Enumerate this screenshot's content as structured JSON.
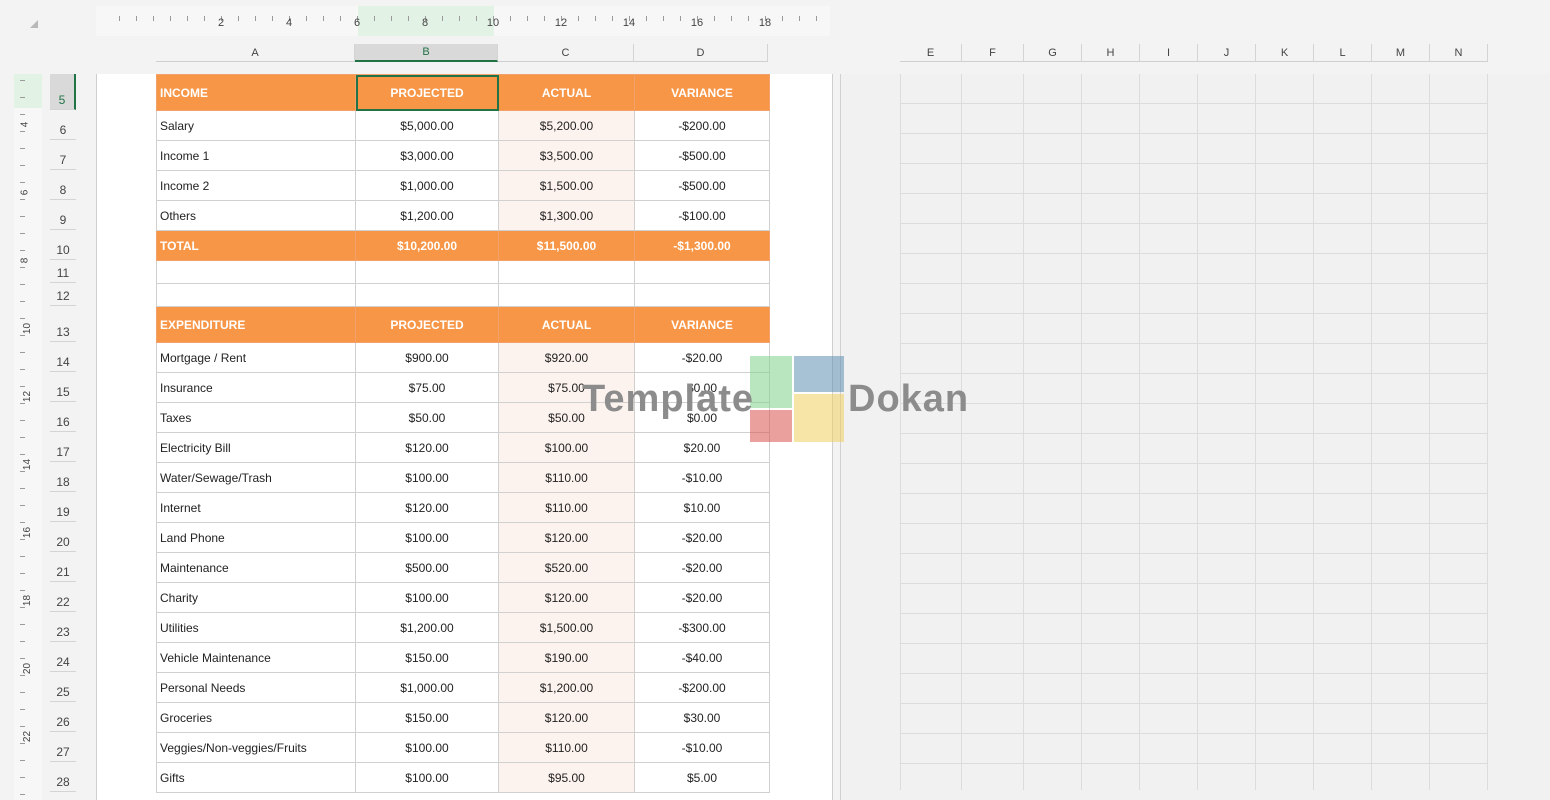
{
  "ruler": {
    "numbers": [
      "2",
      "4",
      "6",
      "8",
      "10",
      "12",
      "14",
      "16",
      "18"
    ],
    "vnumbers": [
      "4",
      "6",
      "8",
      "10",
      "12",
      "14",
      "16",
      "18",
      "20",
      "22"
    ]
  },
  "columns": [
    "A",
    "B",
    "C",
    "D",
    "E",
    "F",
    "G",
    "H",
    "I",
    "J",
    "K",
    "L",
    "M",
    "N"
  ],
  "rows": [
    "5",
    "6",
    "7",
    "8",
    "9",
    "10",
    "11",
    "12",
    "13",
    "14",
    "15",
    "16",
    "17",
    "18",
    "19",
    "20",
    "21",
    "22",
    "23",
    "24",
    "25",
    "26",
    "27",
    "28"
  ],
  "income": {
    "header": [
      "INCOME",
      "PROJECTED",
      "ACTUAL",
      "VARIANCE"
    ],
    "items": [
      [
        "Salary",
        "$5,000.00",
        "$5,200.00",
        "-$200.00"
      ],
      [
        "Income 1",
        "$3,000.00",
        "$3,500.00",
        "-$500.00"
      ],
      [
        "Income 2",
        "$1,000.00",
        "$1,500.00",
        "-$500.00"
      ],
      [
        "Others",
        "$1,200.00",
        "$1,300.00",
        "-$100.00"
      ]
    ],
    "total": [
      "TOTAL",
      "$10,200.00",
      "$11,500.00",
      "-$1,300.00"
    ]
  },
  "expenditure": {
    "header": [
      "EXPENDITURE",
      "PROJECTED",
      "ACTUAL",
      "VARIANCE"
    ],
    "items": [
      [
        "Mortgage / Rent",
        "$900.00",
        "$920.00",
        "-$20.00"
      ],
      [
        "Insurance",
        "$75.00",
        "$75.00",
        "$0.00"
      ],
      [
        "Taxes",
        "$50.00",
        "$50.00",
        "$0.00"
      ],
      [
        "Electricity Bill",
        "$120.00",
        "$100.00",
        "$20.00"
      ],
      [
        "Water/Sewage/Trash",
        "$100.00",
        "$110.00",
        "-$10.00"
      ],
      [
        "Internet",
        "$120.00",
        "$110.00",
        "$10.00"
      ],
      [
        "Land Phone",
        "$100.00",
        "$120.00",
        "-$20.00"
      ],
      [
        "Maintenance",
        "$500.00",
        "$520.00",
        "-$20.00"
      ],
      [
        "Charity",
        "$100.00",
        "$120.00",
        "-$20.00"
      ],
      [
        "Utilities",
        "$1,200.00",
        "$1,500.00",
        "-$300.00"
      ],
      [
        "Vehicle Maintenance",
        "$150.00",
        "$190.00",
        "-$40.00"
      ],
      [
        "Personal Needs",
        "$1,000.00",
        "$1,200.00",
        "-$200.00"
      ],
      [
        "Groceries",
        "$150.00",
        "$120.00",
        "$30.00"
      ],
      [
        "Veggies/Non-veggies/Fruits",
        "$100.00",
        "$110.00",
        "-$10.00"
      ],
      [
        "Gifts",
        "$100.00",
        "$95.00",
        "$5.00"
      ]
    ]
  },
  "watermark": {
    "word1": "Template",
    "word2": "Dokan"
  },
  "colors": {
    "header_orange": "#f79646",
    "selection_green": "#217346",
    "actual_tint": "#fdf3ee"
  }
}
